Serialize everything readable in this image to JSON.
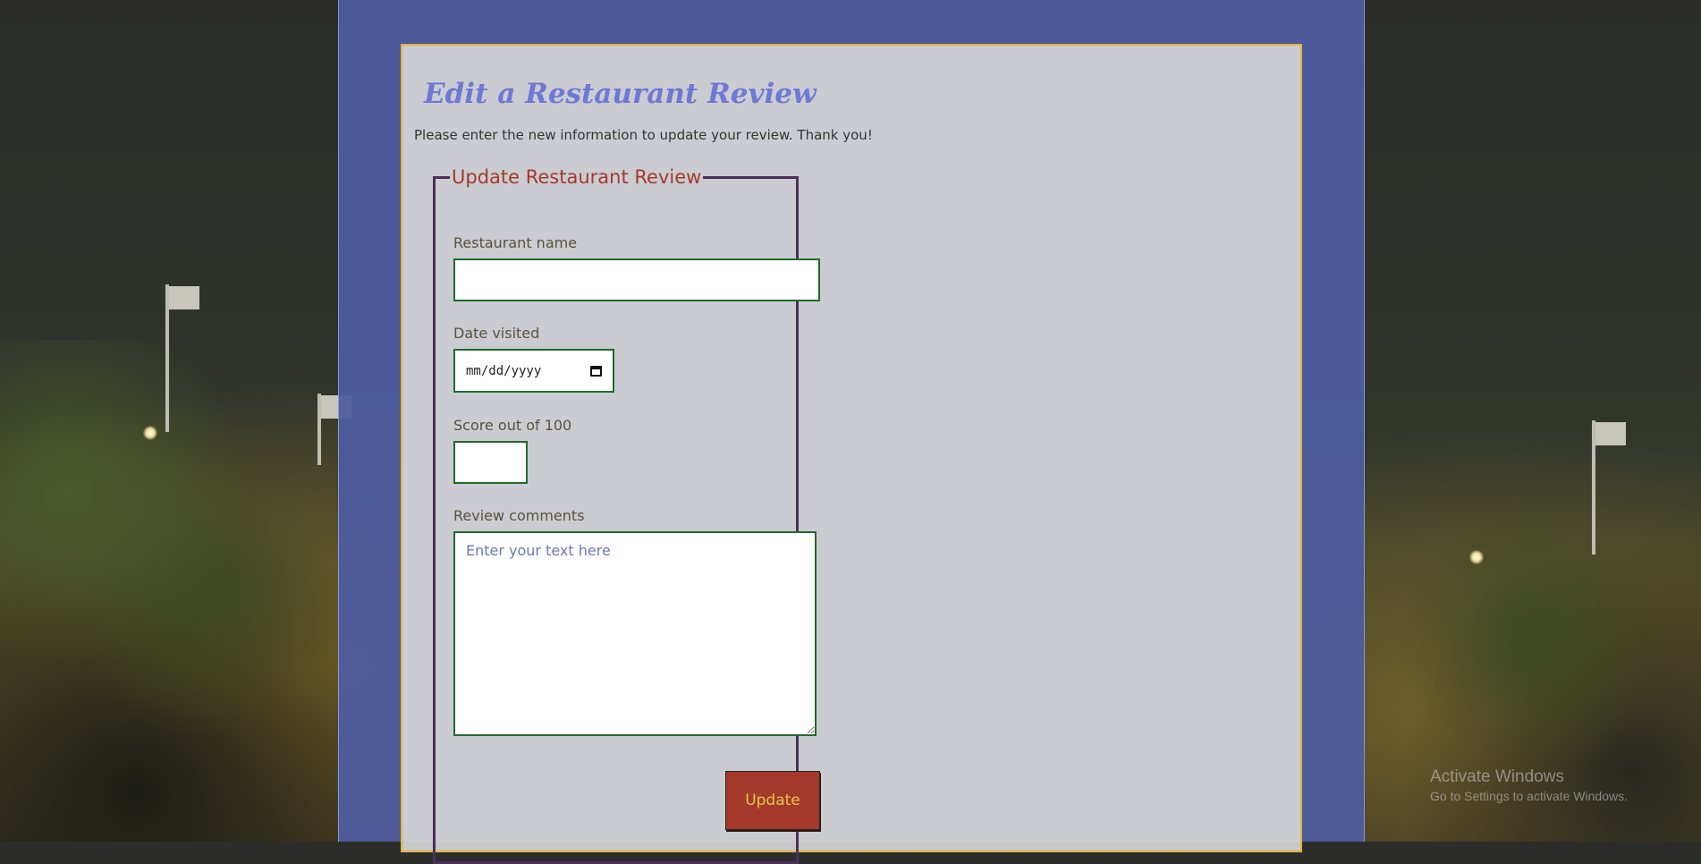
{
  "page": {
    "title": "Edit a Restaurant Review",
    "intro": "Please enter the new information to update your review. Thank you!"
  },
  "form": {
    "legend": "Update Restaurant Review",
    "restaurant_name": {
      "label": "Restaurant name",
      "value": ""
    },
    "date_visited": {
      "label": "Date visited",
      "placeholder": "mm/dd/yyyy",
      "value": ""
    },
    "score": {
      "label": "Score out of 100",
      "value": ""
    },
    "comments": {
      "label": "Review comments",
      "placeholder": "Enter your text here",
      "value": ""
    },
    "submit_label": "Update"
  },
  "watermark": {
    "title": "Activate Windows",
    "subtitle": "Go to Settings to activate Windows."
  },
  "colors": {
    "column_bg": "#4e5ca0",
    "card_border": "#e0b43c",
    "title": "#6d79d4",
    "legend": "#a4392b",
    "fieldset_border": "#4b2f5c",
    "input_border": "#1f6b2b",
    "button_bg": "#a4392b",
    "button_text": "#e7c44a"
  },
  "icons": {
    "date_picker": "calendar-icon"
  }
}
